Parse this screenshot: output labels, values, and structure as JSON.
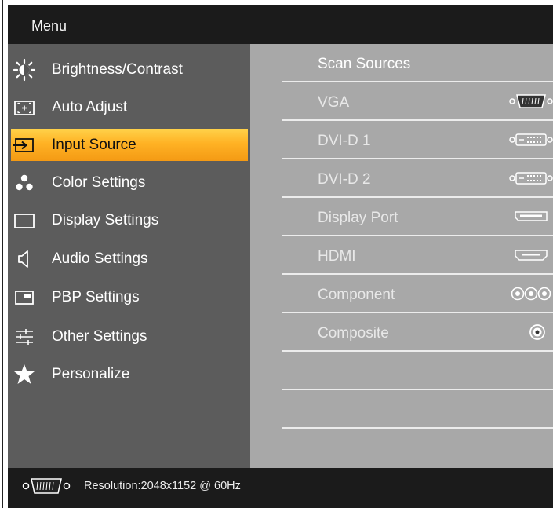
{
  "window": {
    "title": "Menu"
  },
  "menu": {
    "items": [
      {
        "label": "Brightness/Contrast",
        "icon": "sun-icon"
      },
      {
        "label": "Auto Adjust",
        "icon": "auto-adjust-icon"
      },
      {
        "label": "Input Source",
        "icon": "input-source-icon",
        "selected": true
      },
      {
        "label": "Color Settings",
        "icon": "color-dots-icon"
      },
      {
        "label": "Display Settings",
        "icon": "display-rectangle-icon"
      },
      {
        "label": "Audio Settings",
        "icon": "speaker-icon"
      },
      {
        "label": "PBP Settings",
        "icon": "pbp-window-icon"
      },
      {
        "label": "Other Settings",
        "icon": "sliders-icon"
      },
      {
        "label": "Personalize",
        "icon": "star-icon"
      }
    ]
  },
  "sources": {
    "items": [
      {
        "label": "Scan Sources",
        "icon": ""
      },
      {
        "label": "VGA",
        "icon": "vga-connector-icon"
      },
      {
        "label": "DVI-D 1",
        "icon": "dvi-connector-icon"
      },
      {
        "label": "DVI-D 2",
        "icon": "dvi-connector-icon"
      },
      {
        "label": "Display Port",
        "icon": "displayport-connector-icon"
      },
      {
        "label": "HDMI",
        "icon": "hdmi-connector-icon"
      },
      {
        "label": "Component",
        "icon": "component-rca-icon"
      },
      {
        "label": "Composite",
        "icon": "composite-rca-icon"
      },
      {
        "label": "",
        "icon": ""
      },
      {
        "label": "",
        "icon": ""
      }
    ]
  },
  "status": {
    "resolution": "Resolution:2048x1152 @ 60Hz",
    "icon": "vga-connector-icon"
  },
  "colors": {
    "selected_gradient": [
      "#ffd24a",
      "#f49a14"
    ],
    "left_panel": "#5c5c5c",
    "right_panel": "#a8a8a8",
    "bars": "#1b1b1b"
  }
}
